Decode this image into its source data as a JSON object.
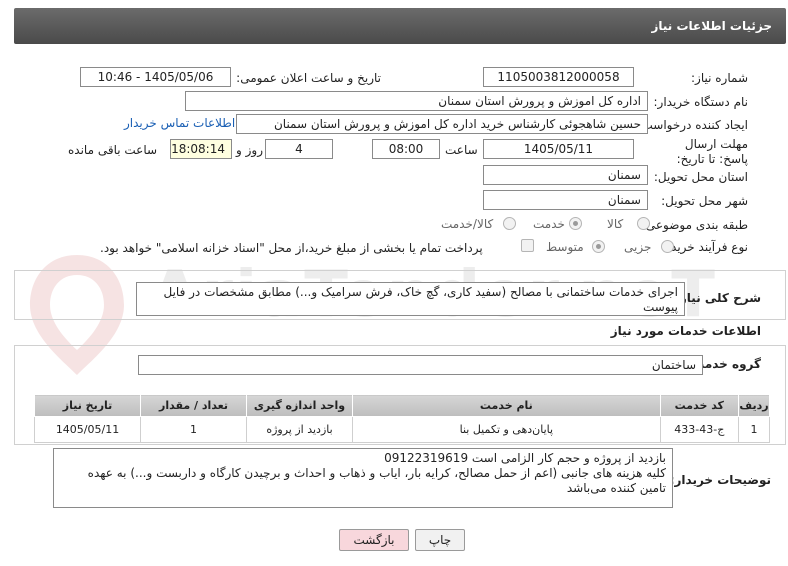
{
  "header": {
    "title": "جزئیات اطلاعات نیاز"
  },
  "form": {
    "need_number_label": "شماره نیاز:",
    "need_number": "1105003812000058",
    "announce_label": "تاریخ و ساعت اعلان عمومی:",
    "announce_value": "1405/05/06 - 10:46",
    "buyer_label": "نام دستگاه خریدار:",
    "buyer_value": "اداره کل اموزش و پرورش استان سمنان",
    "creator_label": "ایجاد کننده درخواست:",
    "creator_value": "حسین شاهجوئی کارشناس خرید اداره کل اموزش و پرورش استان سمنان",
    "contact_link": "اطلاعات تماس خریدار",
    "deadline_label": "مهلت ارسال پاسخ: تا تاریخ:",
    "deadline_date": "1405/05/11",
    "time_label": "ساعت",
    "deadline_time": "08:00",
    "days_value": "4",
    "days_label": "روز و",
    "remaining_time": "18:08:14",
    "remaining_label": "ساعت باقی مانده",
    "province_label": "استان محل تحویل:",
    "province_value": "سمنان",
    "city_label": "شهر محل تحویل:",
    "city_value": "سمنان",
    "category_label": "طبقه بندی موضوعی:",
    "category_options": [
      "کالا",
      "خدمت",
      "کالا/خدمت"
    ],
    "category_selected": "خدمت",
    "process_label": "نوع فرآیند خرید :",
    "process_options": [
      "جزیی",
      "متوسط"
    ],
    "process_selected": "متوسط",
    "treasury_note": "پرداخت تمام یا بخشی از مبلغ خرید،از محل \"اسناد خزانه اسلامی\" خواهد بود."
  },
  "description": {
    "label": "شرح کلی نیاز:",
    "text": "اجرای خدمات ساختمانی با مصالح (سفید کاری، گچ خاک، فرش سرامیک و...) مطابق مشخصات در فایل پیوست"
  },
  "services": {
    "section_title": "اطلاعات خدمات مورد نیاز",
    "group_label": "گروه خدمت:",
    "group_value": "ساختمان",
    "columns": [
      "ردیف",
      "کد خدمت",
      "نام خدمت",
      "واحد اندازه گیری",
      "تعداد / مقدار",
      "تاریخ نیاز"
    ],
    "rows": [
      {
        "index": "1",
        "code": "ج-43-433",
        "name": "پایان‌دهی و تکمیل بنا",
        "unit": "بازدید از پروژه",
        "qty": "1",
        "date": "1405/05/11"
      }
    ]
  },
  "buyer_notes": {
    "label": "توضیحات خریدار:",
    "line1": "بازدید از پروژه و حجم کار الزامی است 09122319619",
    "line2": "کلیه هزینه های جانبی (اعم از حمل مصالح، کرایه بار، ایاب و ذهاب و احداث و برچیدن کارگاه و داربست و...) به عهده تامین کننده می‌باشد"
  },
  "buttons": {
    "print": "چاپ",
    "back": "بازگشت"
  },
  "colors": {
    "header_bg": "#555555",
    "link": "#1a5fb4",
    "back_button": "#f8d7dc"
  }
}
